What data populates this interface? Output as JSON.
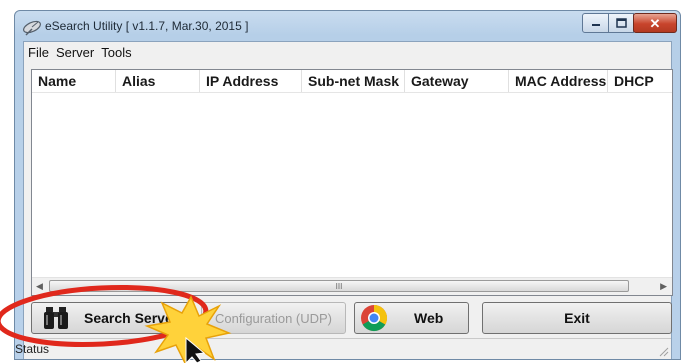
{
  "window": {
    "title": "eSearch Utility [ v1.1.7, Mar.30, 2015 ]"
  },
  "menu": [
    "File",
    "Server",
    "Tools"
  ],
  "table": {
    "columns": [
      "Name",
      "Alias",
      "IP Address",
      "Sub-net Mask",
      "Gateway",
      "MAC Address",
      "DHCP"
    ],
    "rows": []
  },
  "scrollbar": {
    "grip": "III"
  },
  "buttons": {
    "search": "Search Servers",
    "configuration": "Configuration (UDP)",
    "web": "Web",
    "exit": "Exit"
  },
  "status": {
    "text": "Status"
  },
  "icons": {
    "app": "satellite-dish-icon",
    "search": "binoculars-icon",
    "web": "chrome-icon",
    "minimize": "minimize-icon",
    "maximize": "maximize-icon",
    "close": "close-icon"
  },
  "colors": {
    "highlight_ellipse": "#e0281c",
    "burst": "#ffd23a"
  }
}
